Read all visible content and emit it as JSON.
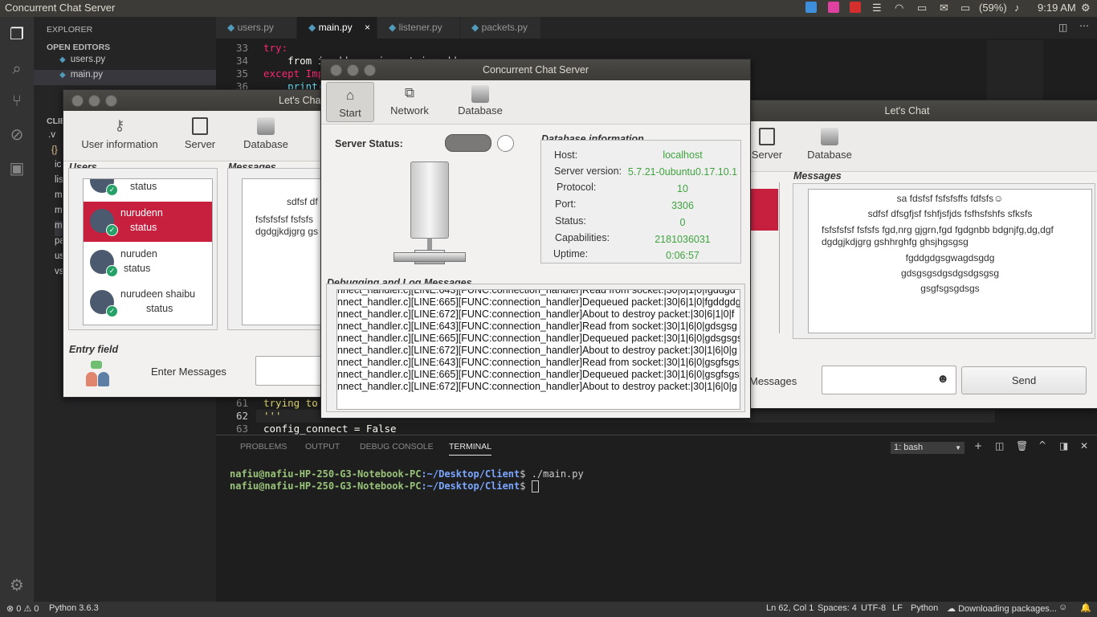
{
  "topbar": {
    "title": "Concurrent Chat Server",
    "battery": "(59%)",
    "clock": "9:19 AM"
  },
  "explorer": {
    "header": "EXPLORER",
    "open_editors": "OPEN EDITORS",
    "open_files": [
      "users.py",
      "main.py"
    ],
    "client_header": "CLIE",
    "tree": [
      ".v",
      "{}",
      "ic",
      "lis",
      "m",
      "m",
      "m",
      "pa",
      "us",
      "vs"
    ]
  },
  "tabs": [
    "users.py",
    "main.py",
    "listener.py",
    "packets.py"
  ],
  "tab_close": "×",
  "editor": {
    "lines": [
      {
        "n": "33",
        "code": "try:"
      },
      {
        "n": "34",
        "code": "    from ipaddress import ip_address"
      },
      {
        "n": "35",
        "code": "except Impo"
      },
      {
        "n": "36",
        "code": "    print("
      },
      {
        "n": "61",
        "code": "trying to"
      },
      {
        "n": "62",
        "code": "'''"
      },
      {
        "n": "63",
        "code": "config_connect = False"
      }
    ]
  },
  "panel": {
    "tabs": [
      "PROBLEMS",
      "OUTPUT",
      "DEBUG CONSOLE",
      "TERMINAL"
    ],
    "shell_select": "1: bash",
    "terminal": [
      {
        "prompt": "nafiu@nafiu-HP-250-G3-Notebook-PC",
        "path": ":~/Desktop/Client",
        "cmd": "$ ./main.py"
      },
      {
        "prompt": "nafiu@nafiu-HP-250-G3-Notebook-PC",
        "path": ":~/Desktop/Client",
        "cmd": "$ "
      }
    ]
  },
  "statusbar": {
    "errors": "0",
    "warnings": "0",
    "python": "Python 3.6.3",
    "position": "Ln 62, Col 1",
    "spaces": "Spaces: 4",
    "encoding": "UTF-8",
    "eol": "LF",
    "language": "Python",
    "downloading": "Downloading packages..."
  },
  "chat_left": {
    "title": "Let's Chat",
    "toolbar": [
      "User information",
      "Server",
      "Database"
    ],
    "users_label": "Users",
    "messages_label": "Messages",
    "users": [
      {
        "name": "",
        "status": "status"
      },
      {
        "name": "nurudenn",
        "status": "status"
      },
      {
        "name": "nuruden",
        "status": "status"
      },
      {
        "name": "nurudeen shaibu",
        "status": "status"
      }
    ],
    "messages": [
      "sdfsf df",
      "fsfsfsfsf fsfsfs",
      "dgdgjkdjgrg gs"
    ],
    "entry_label": "Entry field",
    "enter_messages": "Enter Messages"
  },
  "chat_right": {
    "title": "Let's Chat",
    "toolbar": [
      "Server",
      "Database"
    ],
    "messages_label": "Messages",
    "messages": [
      "sa fdsfsf fsfsfsffs fdfsfs☺",
      "sdfsf dfsgfjsf fshfjsfjds fsfhsfshfs sfksfs",
      "fsfsfsfsf fsfsfs fgd,nrg gjgrn,fgd fgdgnbb bdgnjfg,dg,dgf",
      "dgdgjkdjgrg gshhrghfg ghsjhgsgsg",
      "fgddgdgsgwagdsgdg",
      "gdsgsgsdgsdgsdgsgsg",
      "gsgfsgsgdsgs"
    ],
    "enter_messages": "Messages",
    "send": "Send"
  },
  "server": {
    "title": "Concurrent Chat Server",
    "toolbar": [
      "Start",
      "Network",
      "Database"
    ],
    "status_label": "Server Status:",
    "db_label": "Database information",
    "db": [
      {
        "k": "Host:",
        "v": "localhost"
      },
      {
        "k": "Server version:",
        "v": "5.7.21-0ubuntu0.17.10.1"
      },
      {
        "k": "Protocol:",
        "v": "10"
      },
      {
        "k": "Port:",
        "v": "3306"
      },
      {
        "k": "Status:",
        "v": "0"
      },
      {
        "k": "Capabilities:",
        "v": "2181036031"
      },
      {
        "k": "Uptime:",
        "v": "0:06:57"
      }
    ],
    "log_label": "Debugging and Log Messages",
    "log": [
      "nnect_handler.c][LINE:643][FUNC:connection_handler]Read from socket:|30|6|1|0|fgddgd",
      "nnect_handler.c][LINE:665][FUNC:connection_handler]Dequeued packet:|30|6|1|0|fgddgdg",
      "nnect_handler.c][LINE:672][FUNC:connection_handler]About to destroy packet:|30|6|1|0|f",
      "nnect_handler.c][LINE:643][FUNC:connection_handler]Read from socket:|30|1|6|0|gdsgsg",
      "nnect_handler.c][LINE:665][FUNC:connection_handler]Dequeued packet:|30|1|6|0|gdsgsgs",
      "nnect_handler.c][LINE:672][FUNC:connection_handler]About to destroy packet:|30|1|6|0|g",
      "nnect_handler.c][LINE:643][FUNC:connection_handler]Read from socket:|30|1|6|0|gsgfsgs",
      "nnect_handler.c][LINE:665][FUNC:connection_handler]Dequeued packet:|30|1|6|0|gsgfsgs",
      "nnect_handler.c][LINE:672][FUNC:connection_handler]About to destroy packet:|30|1|6|0|g"
    ]
  }
}
